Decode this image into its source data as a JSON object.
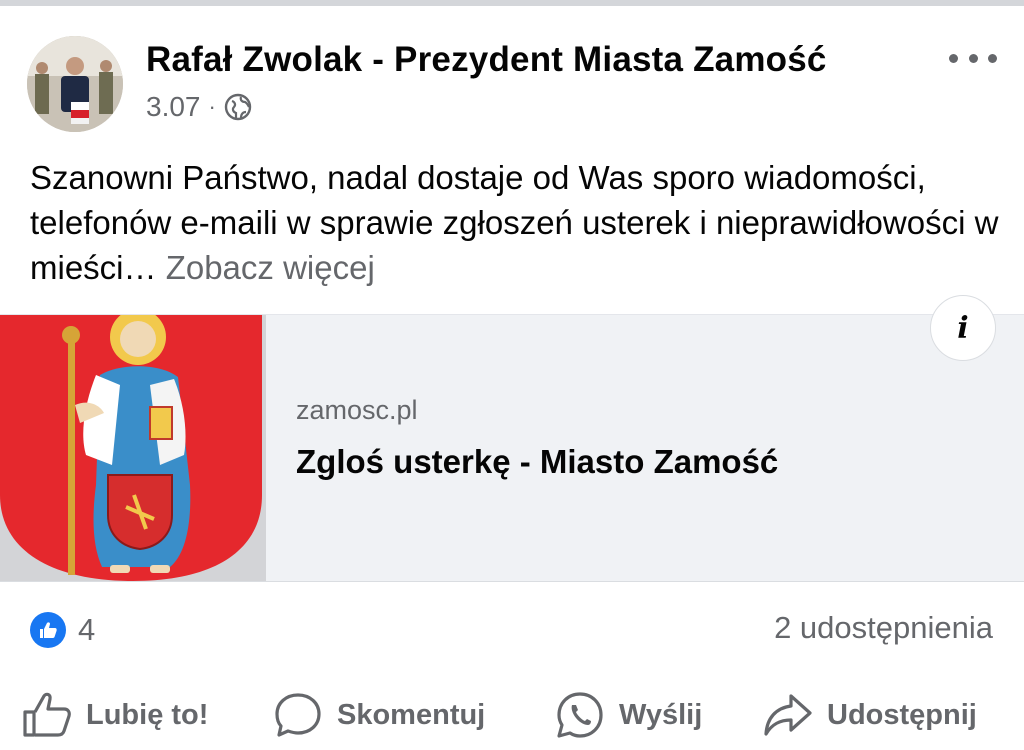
{
  "post": {
    "author": "Rafał Zwolak - Prezydent Miasta Zamość",
    "date": "3.07",
    "separator": "·",
    "privacy_icon": "globe-icon",
    "text": "Szanowni Państwo, nadal dostaje od Was sporo wiadomości, telefonów e-maili w sprawie zgłoszeń usterek i nieprawidłowości w mieści…",
    "see_more": "Zobacz więcej"
  },
  "link_preview": {
    "domain": "zamosc.pl",
    "title": "Zgloś usterkę - Miasto Zamość",
    "info_label": "i",
    "thumbnail": "coat-of-arms-of-zamosc"
  },
  "engagement": {
    "reaction_icon": "like-reaction-icon",
    "reaction_count": "4",
    "shares": "2 udostępnienia"
  },
  "actions": {
    "like": "Lubię to!",
    "comment": "Skomentuj",
    "send": "Wyślij",
    "share": "Udostępnij"
  },
  "colors": {
    "accent": "#1877f2",
    "secondary_text": "#65676b",
    "card_bg": "#f0f2f5",
    "arms_red": "#e5282d"
  }
}
